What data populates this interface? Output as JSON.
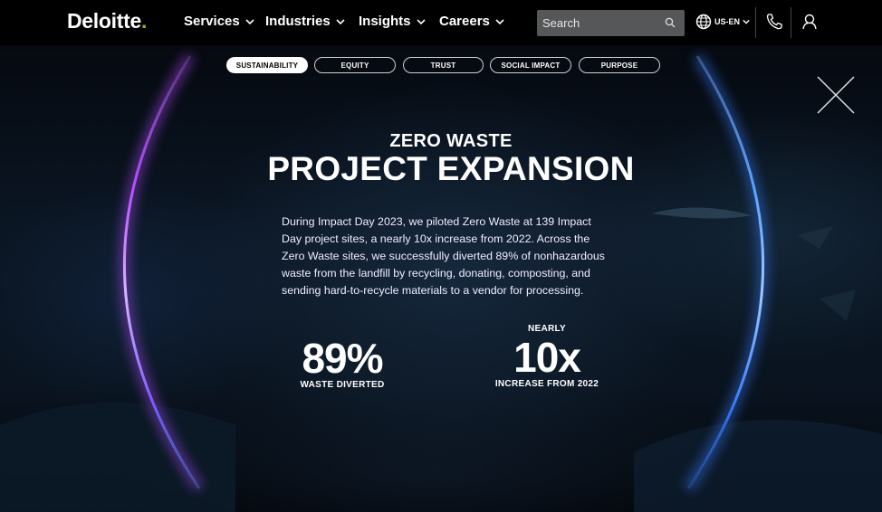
{
  "header": {
    "logo_text": "Deloitte",
    "logo_dot": ".",
    "brand_color": "#86BC25",
    "nav": [
      {
        "label": "Services"
      },
      {
        "label": "Industries"
      },
      {
        "label": "Insights"
      },
      {
        "label": "Careers"
      }
    ],
    "search": {
      "placeholder": "Search"
    },
    "locale": "US-EN"
  },
  "tabs": [
    {
      "label": "SUSTAINABILITY",
      "active": true
    },
    {
      "label": "EQUITY",
      "active": false
    },
    {
      "label": "TRUST",
      "active": false
    },
    {
      "label": "SOCIAL IMPACT",
      "active": false
    },
    {
      "label": "PURPOSE",
      "active": false
    }
  ],
  "content": {
    "eyebrow": "ZERO WASTE",
    "title": "PROJECT EXPANSION",
    "body": "During Impact Day 2023, we piloted Zero Waste at 139 Impact Day project sites, a nearly 10x increase from 2022. Across the Zero Waste sites, we successfully diverted 89% of nonhazardous waste from the landfill by recycling, donating, composting, and sending hard-to-recycle materials to a vendor for processing.",
    "stats": [
      {
        "prefix": "",
        "value": "89%",
        "label": "WASTE DIVERTED"
      },
      {
        "prefix": "NEARLY",
        "value": "10x",
        "label": "INCREASE FROM 2022"
      }
    ]
  },
  "icons": {
    "search": "search-icon",
    "globe": "globe-icon",
    "phone": "phone-icon",
    "user": "user-icon",
    "close": "close-icon"
  }
}
